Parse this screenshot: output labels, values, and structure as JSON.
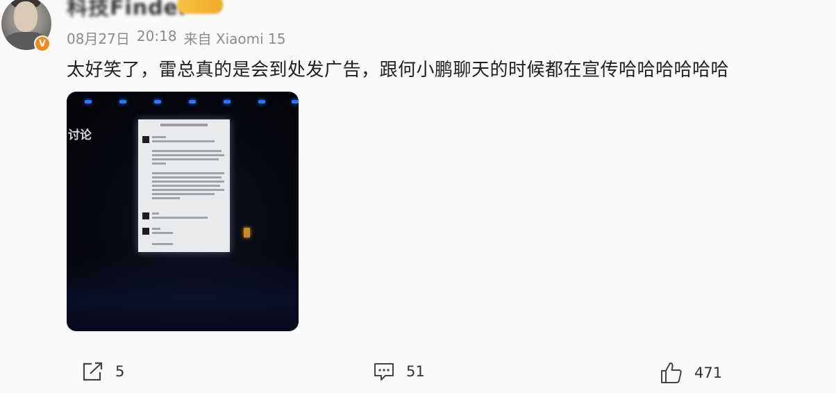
{
  "post": {
    "author": {
      "name": "科技Finder",
      "verified_icon": "verified-badge-icon",
      "verified_glyph": "V"
    },
    "meta": {
      "date": "08月27日",
      "time": "20:18",
      "source": "来自 Xiaomi 15"
    },
    "text": "太好笑了，雷总真的是会到处发广告，跟何小鹏聊天的时候都在宣传哈哈哈哈哈哈",
    "image": {
      "caption": "讨论"
    },
    "actions": {
      "repost": {
        "icon": "share-icon",
        "count": "5"
      },
      "comment": {
        "icon": "comment-icon",
        "count": "51"
      },
      "like": {
        "icon": "thumbs-up-icon",
        "count": "471"
      }
    }
  },
  "colors": {
    "verified": "#f28b1d",
    "meta_text": "#8c8c8c",
    "stage_light": "#2f74ff"
  }
}
